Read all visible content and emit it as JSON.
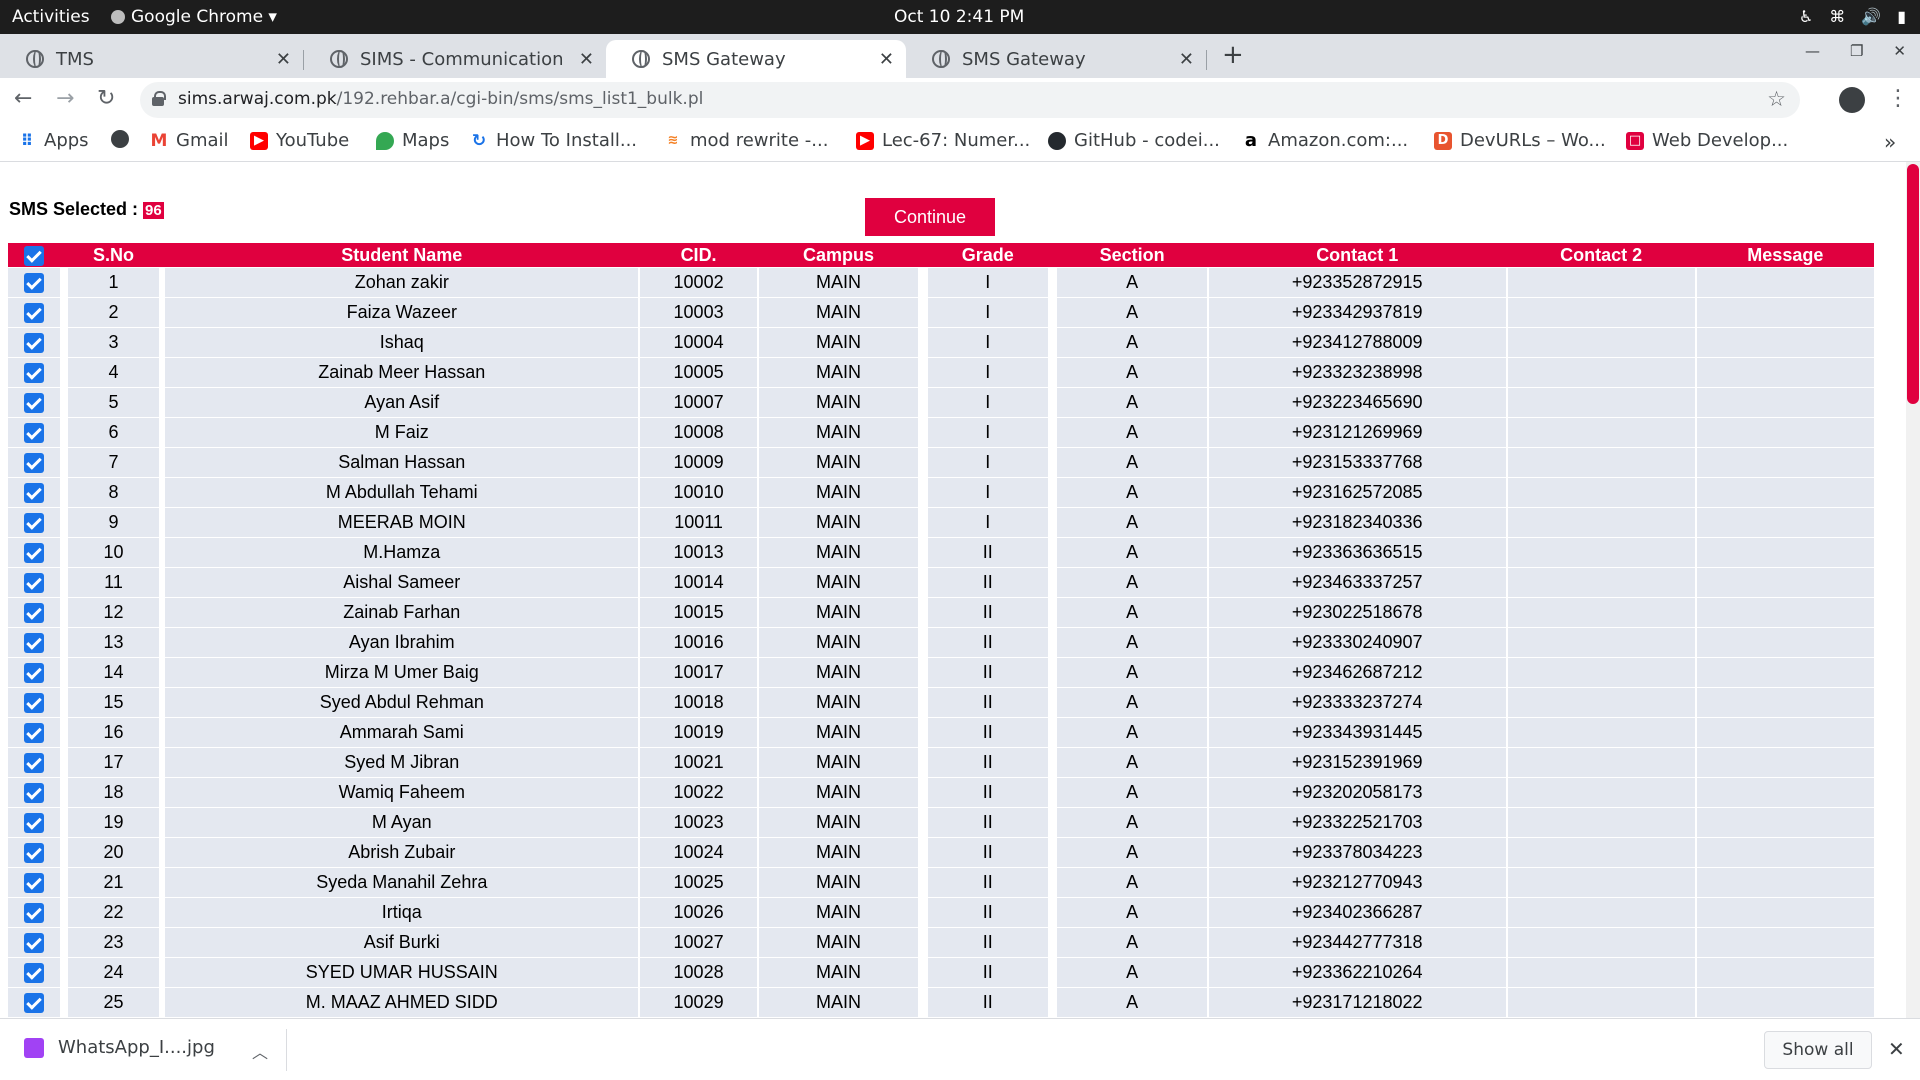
{
  "os_bar": {
    "activities": "Activities",
    "app_name": "Google Chrome ▾",
    "clock": "Oct 10  2:41 PM"
  },
  "tabs": [
    {
      "label": "TMS"
    },
    {
      "label": "SIMS - Communication"
    },
    {
      "label": "SMS Gateway"
    },
    {
      "label": "SMS Gateway"
    }
  ],
  "address_bar": {
    "host": "sims.arwaj.com.pk",
    "path": "/192.rehbar.a/cgi-bin/sms/sms_list1_bulk.pl"
  },
  "bookmarks": [
    {
      "label": "Apps",
      "icon": "apps-grid-icon"
    },
    {
      "label": "",
      "icon": "globe-icon"
    },
    {
      "label": "Gmail",
      "icon": "gmail-icon"
    },
    {
      "label": "YouTube",
      "icon": "youtube-icon"
    },
    {
      "label": "Maps",
      "icon": "maps-icon"
    },
    {
      "label": "How To Install...",
      "icon": "refresh-icon"
    },
    {
      "label": "mod rewrite -...",
      "icon": "stack-icon"
    },
    {
      "label": "Lec-67: Numer...",
      "icon": "youtube-icon"
    },
    {
      "label": "GitHub - codei...",
      "icon": "github-icon"
    },
    {
      "label": "Amazon.com:...",
      "icon": "amazon-icon"
    },
    {
      "label": "DevURLs – Wo...",
      "icon": "devurls-icon"
    },
    {
      "label": "Web Develop...",
      "icon": "webdev-icon"
    }
  ],
  "sms": {
    "selected_label": "SMS Selected : ",
    "selected_count": "96",
    "continue_label": "Continue"
  },
  "table": {
    "headers": [
      "S.No",
      "Student Name",
      "CID.",
      "Campus",
      "Grade",
      "Section",
      "Contact 1",
      "Contact 2",
      "Message"
    ],
    "rows": [
      [
        "1",
        "Zohan zakir",
        "10002",
        "MAIN",
        "I",
        "A",
        "+923352872915",
        "",
        ""
      ],
      [
        "2",
        "Faiza Wazeer",
        "10003",
        "MAIN",
        "I",
        "A",
        "+923342937819",
        "",
        ""
      ],
      [
        "3",
        "Ishaq",
        "10004",
        "MAIN",
        "I",
        "A",
        "+923412788009",
        "",
        ""
      ],
      [
        "4",
        "Zainab Meer Hassan",
        "10005",
        "MAIN",
        "I",
        "A",
        "+923323238998",
        "",
        ""
      ],
      [
        "5",
        "Ayan Asif",
        "10007",
        "MAIN",
        "I",
        "A",
        "+923223465690",
        "",
        ""
      ],
      [
        "6",
        "M Faiz",
        "10008",
        "MAIN",
        "I",
        "A",
        "+923121269969",
        "",
        ""
      ],
      [
        "7",
        "Salman Hassan",
        "10009",
        "MAIN",
        "I",
        "A",
        "+923153337768",
        "",
        ""
      ],
      [
        "8",
        "M Abdullah Tehami",
        "10010",
        "MAIN",
        "I",
        "A",
        "+923162572085",
        "",
        ""
      ],
      [
        "9",
        "MEERAB MOIN",
        "10011",
        "MAIN",
        "I",
        "A",
        "+923182340336",
        "",
        ""
      ],
      [
        "10",
        "M.Hamza",
        "10013",
        "MAIN",
        "II",
        "A",
        "+923363636515",
        "",
        ""
      ],
      [
        "11",
        "Aishal Sameer",
        "10014",
        "MAIN",
        "II",
        "A",
        "+923463337257",
        "",
        ""
      ],
      [
        "12",
        "Zainab Farhan",
        "10015",
        "MAIN",
        "II",
        "A",
        "+923022518678",
        "",
        ""
      ],
      [
        "13",
        "Ayan Ibrahim",
        "10016",
        "MAIN",
        "II",
        "A",
        "+923330240907",
        "",
        ""
      ],
      [
        "14",
        "Mirza M Umer Baig",
        "10017",
        "MAIN",
        "II",
        "A",
        "+923462687212",
        "",
        ""
      ],
      [
        "15",
        "Syed Abdul Rehman",
        "10018",
        "MAIN",
        "II",
        "A",
        "+923333237274",
        "",
        ""
      ],
      [
        "16",
        "Ammarah Sami",
        "10019",
        "MAIN",
        "II",
        "A",
        "+923343931445",
        "",
        ""
      ],
      [
        "17",
        "Syed M Jibran",
        "10021",
        "MAIN",
        "II",
        "A",
        "+923152391969",
        "",
        ""
      ],
      [
        "18",
        "Wamiq Faheem",
        "10022",
        "MAIN",
        "II",
        "A",
        "+923202058173",
        "",
        ""
      ],
      [
        "19",
        "M Ayan",
        "10023",
        "MAIN",
        "II",
        "A",
        "+923322521703",
        "",
        ""
      ],
      [
        "20",
        "Abrish Zubair",
        "10024",
        "MAIN",
        "II",
        "A",
        "+923378034223",
        "",
        ""
      ],
      [
        "21",
        "Syeda Manahil Zehra",
        "10025",
        "MAIN",
        "II",
        "A",
        "+923212770943",
        "",
        ""
      ],
      [
        "22",
        "Irtiqa",
        "10026",
        "MAIN",
        "II",
        "A",
        "+923402366287",
        "",
        ""
      ],
      [
        "23",
        "Asif Burki",
        "10027",
        "MAIN",
        "II",
        "A",
        "+923442777318",
        "",
        ""
      ],
      [
        "24",
        "SYED UMAR HUSSAIN",
        "10028",
        "MAIN",
        "II",
        "A",
        "+923362210264",
        "",
        ""
      ],
      [
        "25",
        "M. MAAZ AHMED SIDD",
        "10029",
        "MAIN",
        "II",
        "A",
        "+923171218022",
        "",
        ""
      ]
    ]
  },
  "downloads": {
    "file_name": "WhatsApp_I....jpg",
    "show_all_label": "Show all"
  },
  "colors": {
    "accent": "#e0003f",
    "row_bg": "#e4e8f0",
    "checkbox": "#1a73e8"
  }
}
